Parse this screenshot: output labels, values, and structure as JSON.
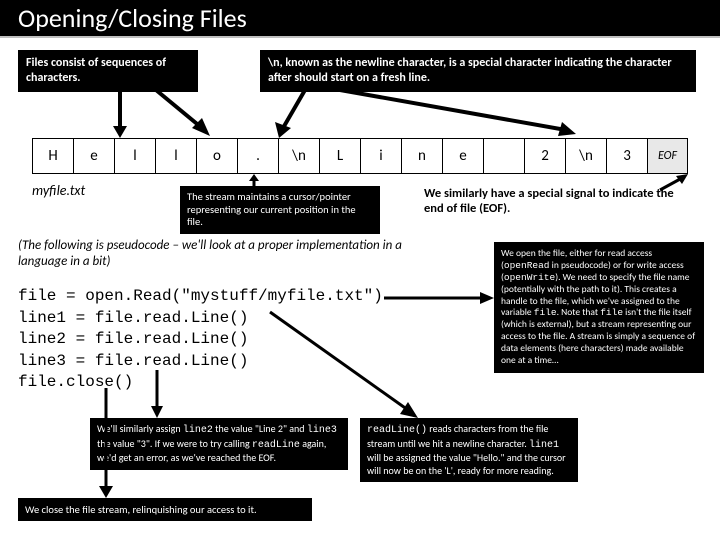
{
  "title": "Opening/Closing Files",
  "box_left": "Files consist of sequences of characters.",
  "box_right": "\\n, known as the newline character, is a special character indicating the character after should start on a fresh line.",
  "cells": [
    "H",
    "e",
    "l",
    "l",
    "o",
    ".",
    "\\n",
    "L",
    "i",
    "n",
    "e",
    " ",
    "2",
    "\\n",
    "3",
    "EOF"
  ],
  "filename": "myfile.txt",
  "mid_left": "The stream maintains a cursor/pointer representing our current position in the file.",
  "mid_right": "We similarly have a special signal to indicate the end of file (EOF).",
  "pseudo_note": "(The following is pseudocode – we'll look at a proper implementation in a language in a bit)",
  "code": {
    "l1": "file = open.Read(\"mystuff/myfile.txt\")",
    "l2": "line1 = file.read.Line()",
    "l3": "line2 = file.read.Line()",
    "l4": "line3 = file.read.Line()",
    "l5": "file.close()"
  },
  "longbox_a": "We open the file, either for read access (",
  "longbox_b": "openRead",
  "longbox_c": " in pseudocode) or for write access (",
  "longbox_d": "openWrite",
  "longbox_e": "). We need to specify the file name (potentially with the path to it). This creates a handle to the file, which we've assigned to the variable ",
  "longbox_f": "file",
  "longbox_g": ". Note that ",
  "longbox_h": "file",
  "longbox_i": " isn't the file itself (which is external), but a stream representing our access to the file. A stream is simply a sequence of data elements (here characters) made available one at a time…",
  "bot_left_a": "We'll similarly assign ",
  "bot_left_b": "line2",
  "bot_left_c": " the value \"Line 2\" and ",
  "bot_left_d": "line3",
  "bot_left_e": " the value \"3\". If we were to try calling ",
  "bot_left_f": "readLine",
  "bot_left_g": " again, we'd get an error, as we've reached the EOF.",
  "bot_right_a": "readLine()",
  "bot_right_b": " reads characters from the file stream until we hit a newline character. ",
  "bot_right_c": "line1",
  "bot_right_d": " will be assigned the value \"Hello.\" and the cursor will now be on the 'L', ready for more reading.",
  "closebox": "We close the file stream, relinquishing our access to it."
}
